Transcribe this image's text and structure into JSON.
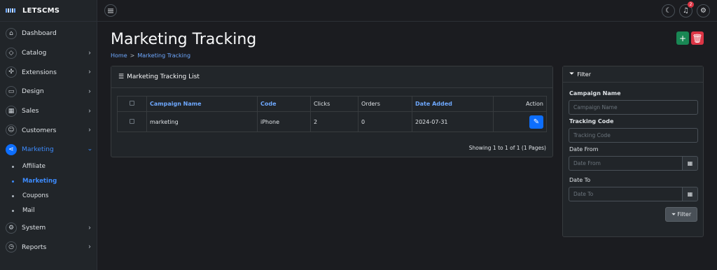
{
  "brand": {
    "name": "LETSCMS"
  },
  "sidebar": {
    "items": [
      {
        "label": "Dashboard",
        "icon": "home-icon",
        "glyph": "⌂",
        "chevron": false
      },
      {
        "label": "Catalog",
        "icon": "tag-icon",
        "glyph": "◇",
        "chevron": true
      },
      {
        "label": "Extensions",
        "icon": "puzzle-icon",
        "glyph": "✣",
        "chevron": true
      },
      {
        "label": "Design",
        "icon": "monitor-icon",
        "glyph": "▭",
        "chevron": true
      },
      {
        "label": "Sales",
        "icon": "shop-icon",
        "glyph": "▦",
        "chevron": true
      },
      {
        "label": "Customers",
        "icon": "user-icon",
        "glyph": "☺",
        "chevron": true
      },
      {
        "label": "Marketing",
        "icon": "share-icon",
        "glyph": "⋖",
        "chevron": true,
        "active": true
      }
    ],
    "marketing_sub": [
      {
        "label": "Affiliate"
      },
      {
        "label": "Marketing",
        "active": true
      },
      {
        "label": "Coupons"
      },
      {
        "label": "Mail"
      }
    ],
    "bottom_items": [
      {
        "label": "System",
        "icon": "gear-icon",
        "glyph": "⚙",
        "chevron": true
      },
      {
        "label": "Reports",
        "icon": "clock-icon",
        "glyph": "◷",
        "chevron": true
      }
    ]
  },
  "topbar": {
    "notification_count": "2"
  },
  "page": {
    "title": "Marketing Tracking",
    "breadcrumb": [
      "Home",
      "Marketing Tracking"
    ],
    "breadcrumb_sep": ">"
  },
  "list": {
    "title": "Marketing Tracking List",
    "columns": [
      "Campaign Name",
      "Code",
      "Clicks",
      "Orders",
      "Date Added",
      "Action"
    ],
    "rows": [
      {
        "campaign_name": "marketing",
        "code": "iPhone",
        "clicks": "2",
        "orders": "0",
        "date_added": "2024-07-31"
      }
    ],
    "showing": "Showing 1 to 1 of 1 (1 Pages)"
  },
  "filter": {
    "title": "Filter",
    "campaign_label": "Campaign Name",
    "campaign_placeholder": "Campaign Name",
    "tracking_label": "Tracking Code",
    "tracking_placeholder": "Tracking Code",
    "date_from_label": "Date From",
    "date_from_placeholder": "Date From",
    "date_to_label": "Date To",
    "date_to_placeholder": "Date To",
    "button_label": "Filter"
  },
  "colors": {
    "accent": "#0d6efd",
    "add": "#198754",
    "delete": "#dc3545",
    "link": "#6ea8fe"
  }
}
